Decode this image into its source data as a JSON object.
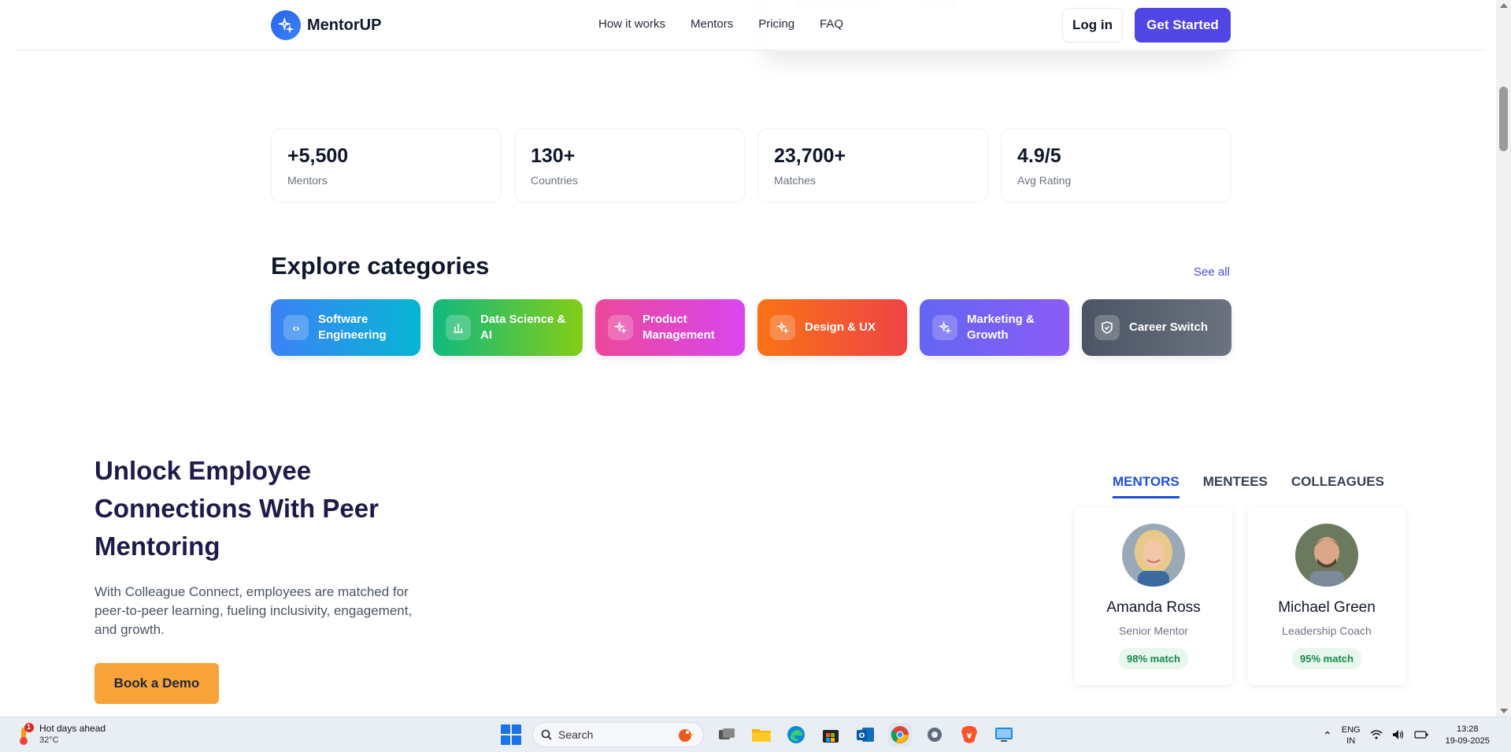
{
  "header": {
    "brand": "MentorUP",
    "nav": [
      "How it works",
      "Mentors",
      "Pricing",
      "FAQ"
    ],
    "login_label": "Log in",
    "cta_label": "Get Started"
  },
  "stats": [
    {
      "value": "+5,500",
      "label": "Mentors"
    },
    {
      "value": "130+",
      "label": "Countries"
    },
    {
      "value": "23,700+",
      "label": "Matches"
    },
    {
      "value": "4.9/5",
      "label": "Avg Rating"
    }
  ],
  "categories": {
    "title": "Explore categories",
    "see_all": "See all",
    "items": [
      {
        "label": "Software Engineering",
        "icon": "code-icon"
      },
      {
        "label": "Data Science & AI",
        "icon": "chart-icon"
      },
      {
        "label": "Product Management",
        "icon": "sparkle-icon"
      },
      {
        "label": "Design & UX",
        "icon": "sparkle-icon"
      },
      {
        "label": "Marketing & Growth",
        "icon": "sparkle-icon"
      },
      {
        "label": "Career Switch",
        "icon": "shield-icon"
      }
    ]
  },
  "hero": {
    "title": "Unlock Employee Connections With Peer Mentoring",
    "description": "With Colleague Connect, employees are matched for peer-to-peer learning, fueling inclusivity, engagement, and growth.",
    "cta": "Book a Demo"
  },
  "tabs": [
    "MENTORS",
    "MENTEES",
    "COLLEAGUES"
  ],
  "profiles": [
    {
      "name": "Amanda Ross",
      "role": "Senior Mentor",
      "match": "98% match"
    },
    {
      "name": "Michael Green",
      "role": "Leadership Coach",
      "match": "95% match"
    }
  ],
  "taskbar": {
    "weather_title": "Hot days ahead",
    "weather_temp": "32°C",
    "weather_badge": "1",
    "search_placeholder": "Search",
    "lang_line1": "ENG",
    "lang_line2": "IN",
    "time": "13:28",
    "date": "19-09-2025"
  },
  "colors": {
    "brand": "#4f46e5",
    "demo": "#f8a23a",
    "tab_active": "#1d4ed8"
  }
}
